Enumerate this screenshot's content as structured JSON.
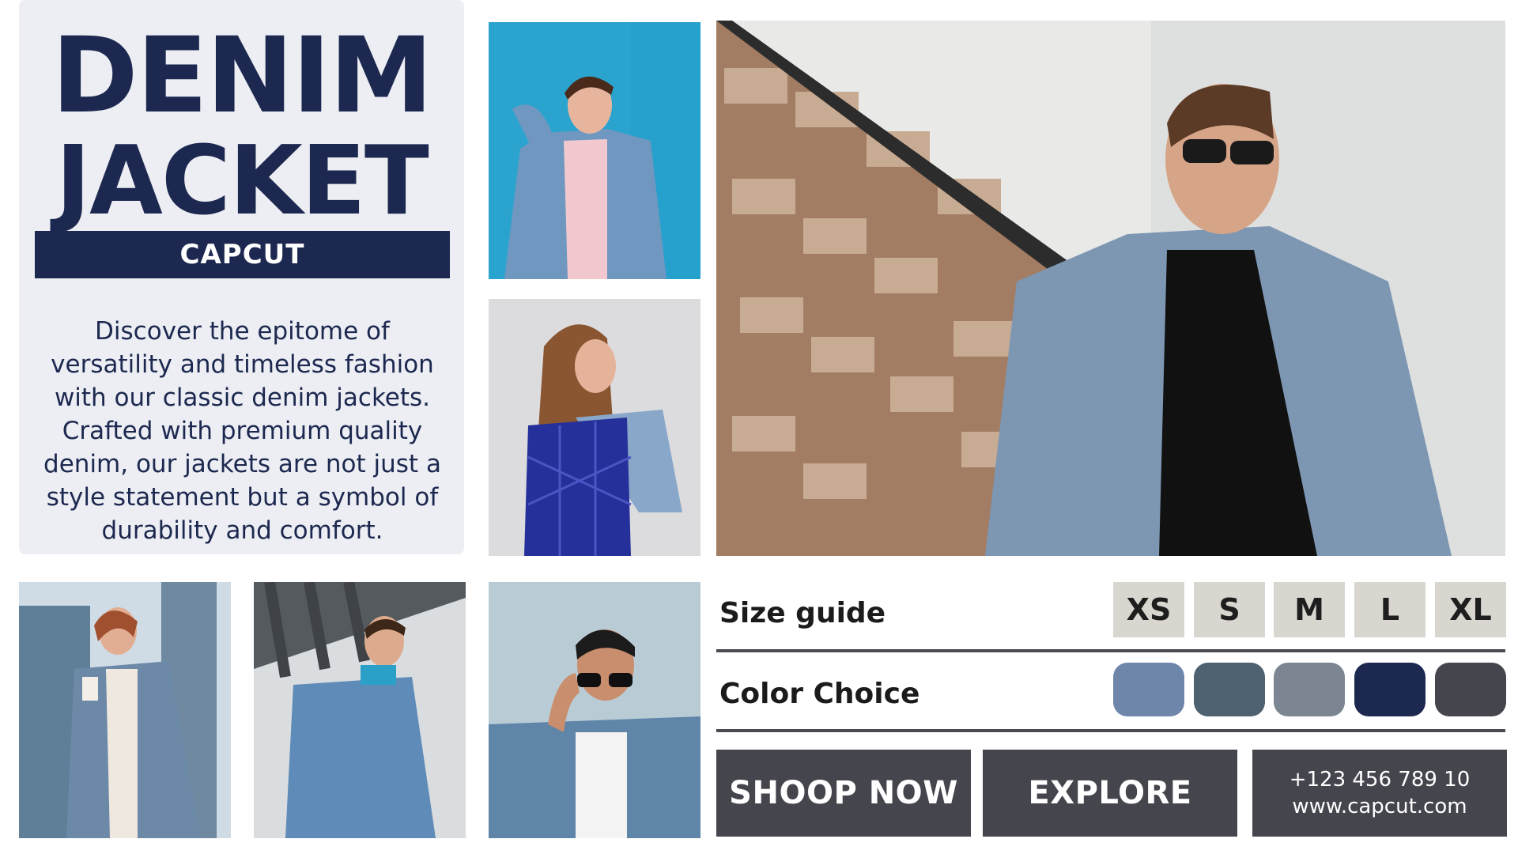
{
  "title": {
    "line1": "DENIM",
    "line2": "JACKET",
    "brand": "CAPCUT"
  },
  "description": "Discover the epitome of versatility and timeless fashion with our classic denim jackets. Crafted with premium quality denim, our jackets are not just a style statement but a symbol of durability and comfort.",
  "size_guide": {
    "label": "Size guide",
    "sizes": [
      "XS",
      "S",
      "M",
      "L",
      "XL"
    ]
  },
  "color_choice": {
    "label": "Color Choice",
    "colors": [
      "#6e86aa",
      "#4d6171",
      "#7b8692",
      "#1c284f",
      "#45464d"
    ]
  },
  "buttons": {
    "shop": "SHOOP NOW",
    "explore": "EXPLORE"
  },
  "contact": {
    "phone": "+123 456 789 10",
    "website": "www.capcut.com"
  },
  "photos": [
    {
      "name": "man-denim-blue-wall-photo"
    },
    {
      "name": "woman-blue-bag-photo"
    },
    {
      "name": "man-brick-wall-sunglasses-photo"
    },
    {
      "name": "woman-coffee-city-photo"
    },
    {
      "name": "man-bridge-photo"
    },
    {
      "name": "man-sunglasses-sky-photo"
    }
  ]
}
